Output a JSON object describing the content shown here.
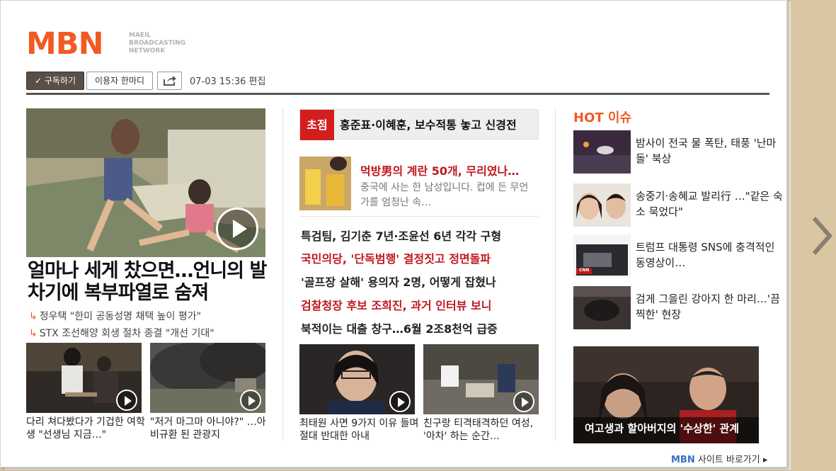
{
  "logo": {
    "text": "MBN",
    "sub": [
      "MAEIL",
      "BROADCASTING",
      "NETWORK"
    ]
  },
  "toolbar": {
    "subscribe_label": "✓ 구독하기",
    "comment_label": "이용자 한마디",
    "share_icon": "share-icon",
    "timestamp": "07-03 15:36 편집"
  },
  "main": {
    "headline": "얼마나 세게 찼으면…언니의 발차기에 복부파열로 숨져",
    "subs": [
      "정우택 \"한미 공동성명 채택 높이 평가\"",
      "STX 조선해양 회생 절차 종결 \"개선 기대\""
    ],
    "cards": [
      {
        "caption": "다리 쳐다봤다가 기겁한 여학생 \"선생님 지금…\""
      },
      {
        "caption": "\"저거 마그마 아니야?\" …아비규환 된 관광지"
      }
    ]
  },
  "focus": {
    "tag": "초점",
    "title": "홍준표·이혜훈, 보수적통 놓고 신경전"
  },
  "feature": {
    "title": "먹방男의 계란 50개, 무리였나…",
    "desc": "중국에 사는 한 남성입니다. 컵에 든 무언가를 엄청난 속…"
  },
  "news": [
    {
      "text": "특검팀, 김기춘 7년·조윤선 6년 각각 구형",
      "red": false
    },
    {
      "text": "국민의당, '단독범행' 결정짓고 정면돌파",
      "red": true
    },
    {
      "text": "'골프장 살해' 용의자 2명, 어떻게 잡혔나",
      "red": false
    },
    {
      "text": "검찰청장 후보 조희진, 과거 인터뷰 보니",
      "red": true
    },
    {
      "text": "북적이는 대출 창구…6월 2조8천억 급증",
      "red": false
    }
  ],
  "mid_cards": [
    {
      "caption": "최태원 사면 9가지 이유 들며 절대 반대한 아내"
    },
    {
      "caption": "친구랑 티격태격하던 여성, '아차' 하는 순간…"
    }
  ],
  "hot": {
    "title": "HOT 이슈",
    "items": [
      {
        "caption": "밤사이 전국 물 폭탄, 태풍 '난마돌' 북상"
      },
      {
        "caption": "송중기·송혜교 발리行 …\"같은 숙소 묵었다\""
      },
      {
        "caption": "트럼프 대통령 SNS에 충격적인 동영상이…"
      },
      {
        "caption": "검게 그을린 강아지 한 마리…'끔찍한' 현장"
      }
    ],
    "big_caption": "여고생과 할아버지의 '수상한' 관계",
    "cnn_text": "CNN"
  },
  "footer": {
    "brand": "MBN",
    "link": " 사이트 바로가기 ▸"
  }
}
